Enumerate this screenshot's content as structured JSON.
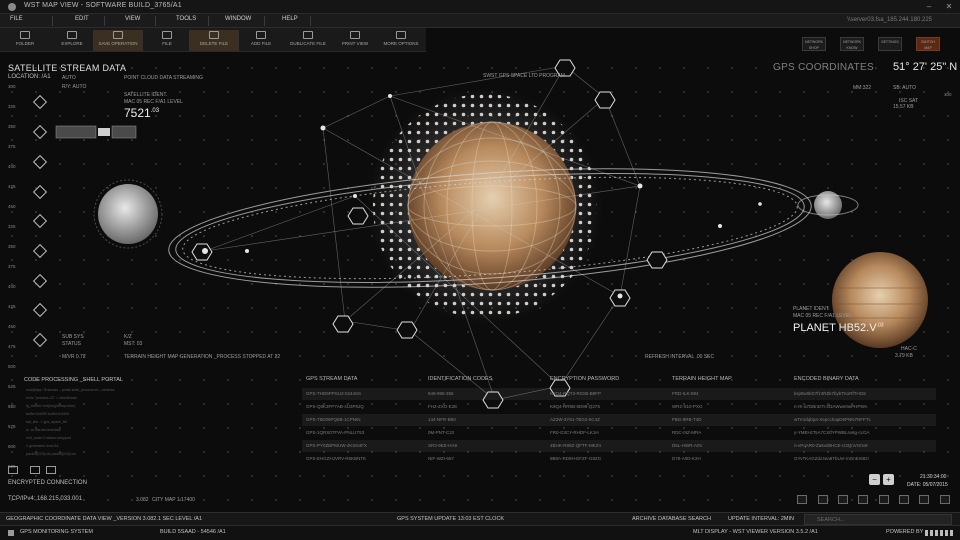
{
  "window": {
    "title": "WST MAP VIEW - SOFTWARE BUILD_3765/A1"
  },
  "menu": {
    "items": [
      "FILE",
      "EDIT",
      "VIEW",
      "TOOLS",
      "WINDOW",
      "HELP"
    ],
    "address": "\\\\server03.fsa_185.244.180.225"
  },
  "toolbar": {
    "items": [
      "FOLDER",
      "EXPLORE",
      "SAVE OPERATION",
      "FILE",
      "DELETE FILE",
      "ADD FILE",
      "DUBLICATE FILE",
      "PRINT VIEW",
      "MORE OPTIONS"
    ],
    "active_index": 2
  },
  "right_toolbar": {
    "items": [
      "NETWORK SHOP",
      "NETWORK KNOW",
      "SETTINGS",
      "SWITCH MAP"
    ]
  },
  "left_panel": {
    "title": "SATELLITE STREAM DATA",
    "location": "LOCATION: /A1",
    "auto1": "AUTO",
    "auto2": "R/Y: AUTO",
    "streaming": "POINT CLOUD DATA STREAMING",
    "ident_label": "SATELLITE IDENT.",
    "ident_sub": "MAC 05 REC F/A1 LEVEL",
    "ident_value": "7521",
    "ident_sup": ".03",
    "sub_label": "SUB SYS",
    "status_label": "STATUS",
    "kz_label": "K/Z",
    "mst_label": "MST: 03",
    "mvr": "M/VR 0.72",
    "terrain_gen": "TERRAIN HEIGHT MAP GENERATION _PROCESS STOPPED AT 22",
    "ruler_ticks": [
      "300",
      "325",
      "350",
      "375",
      "400",
      "425",
      "450",
      "325",
      "350",
      "375",
      "400",
      "425",
      "450",
      "475",
      "500",
      "525",
      "550",
      "575",
      "600",
      "625"
    ]
  },
  "center": {
    "program": "SWST GPS SPACE LTD PROGRAM",
    "refresh": "REFRESH INTERVAL .00 SEC"
  },
  "right_panel": {
    "title": "GPS COORDINATES",
    "coords": "51° 27' 25\" N",
    "mm": "MM:322",
    "sb": "SB: AUTO",
    "isc_label": "ISC SAT",
    "isc_value": "15.57 KB",
    "planet_label": "PLANET IDENT.",
    "planet_sub": "MAC 05 REC F/A1 LEVEL",
    "planet_name": "PLANET HB52.V",
    "planet_sup": ".03",
    "hac_label": "HAC-C",
    "hac_value": "3.79 KB"
  },
  "code": {
    "title": "CODE PROCESSING _SHELL PORTAL",
    "lines": [
      "root@sys:~$ stream --portal shell_process.sh --verbose",
      "echo \"process 22\" > /dev/terrain",
      "fg_render::init(heightmap=true)",
      "buffer:0x00f3 buffer:0x00f4",
      "sat_link -> gps_space_ltd",
      "ls -la /var/stream/data",
      "exit_code=0 status=stopped",
      "// generated level A1",
      "packet[223]=ok packet[224]=ok"
    ]
  },
  "table": {
    "headers": [
      "GPS STREAM DATA",
      "IDENTIFICATION CODES",
      "ENCRYPTION PASSWORD",
      "TERRAIN HEIGHT MAP",
      "ENCODED BINARY DATA"
    ],
    "rows": [
      [
        "GPS-THD6PPSU3-0244SS",
        "549-998-356",
        "K8Q4-RQT3-RG85-B8FP",
        "FRD-ILK-894",
        "ksp8w0kD7fz4RZk7bybTKxRfTHG8"
      ],
      [
        "GPS-Q8K3FP7AB-4U3P8JQ",
        "FH2-ZXG-E2E",
        "K8Q4-RR5B-8D98-Q37S",
        "WR2-S10-PXG",
        "n-rK-a7DBnD7t-3f3AWwe0wPHP9rK"
      ],
      [
        "GPS-T5D06PQ5B-1CPNIN",
        "144-NFR-B50",
        "AZ2W-3Y81-7BG2-5C4Z",
        "FBG-9RB-T4D",
        "wTmrdqbpa-XepcchapD6PNN7NFFTL"
      ],
      [
        "GPS-1QRS0TFVA-PNLU7S3",
        "0M-PNT-C22",
        "FR0-G3CY-RHDF-LK1H",
        "RDC-0IZ-MRA",
        "y-YMEHzTsA7CXtfYPWBLsv6g-ccGA"
      ],
      [
        "GPS-PY0ZBPMUW-4KSN4FX",
        "SR3-9EE-HA9",
        "4BHK-R89Z-QFTF-MKZ4",
        "D6L-HWR-A0V",
        "n-vPqAR0-Za6vd8HCE-U3QnVG0x9"
      ],
      [
        "GPS-EHGZHJVRV-R6KBNTE",
        "NIF-WZI-657",
        "9B8A-RD9H-EFZF-G8ZG",
        "D78-A0D-K2H",
        "GYvTKAGZdz4ea8TbUvr-mGnEr68zI"
      ]
    ]
  },
  "bottom_left": {
    "encrypted": "ENCRYPTED CONNECTION",
    "tcp": "TCP/IPv4: 168.215.033.001",
    "small1": "3.082",
    "small2": "CITY MAP 1:17400"
  },
  "clock": {
    "time": "21:30:34:00",
    "date": "DATE: 05/07/2015"
  },
  "status_bar": {
    "left": "GEOGRAPHIC COORDINATE DATA VIEW _VERSION 3.082.1 SEC LEVEL /A1",
    "middle": "GPS SYSTEM UPDATE 13:03 EST CLOCK",
    "archive": "ARCHIVE DATABASE SEARCH",
    "update": "UPDATE INTERVAL: 2MIN",
    "search_placeholder": "SEARCH..."
  },
  "bottom_bar": {
    "left": "GPS MONITORING SYSTEM",
    "build": "BUILD 5SAAD - 54546 /A1",
    "middle": "MLT DISPLAY - WST VIEWER VERSION 3.5.2 /A1",
    "powered": "POWERED BY"
  },
  "colors": {
    "accent": "#e5e5e5",
    "active_tool": "#3b2f22",
    "background": "#0c0c0d"
  }
}
